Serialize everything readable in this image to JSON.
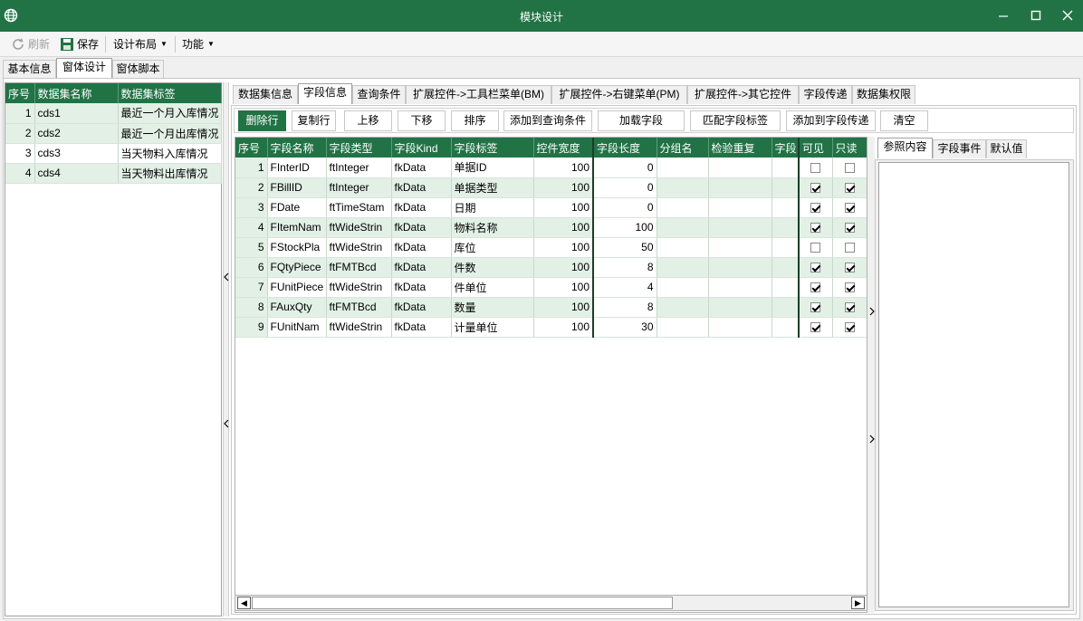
{
  "window": {
    "title": "模块设计"
  },
  "toolbar": {
    "refresh": "刷新",
    "save": "保存",
    "design_layout": "设计布局",
    "functions": "功能"
  },
  "main_tabs": [
    "基本信息",
    "窗体设计",
    "窗体脚本"
  ],
  "dataset_grid": {
    "headers": [
      "序号",
      "数据集名称",
      "数据集标签"
    ],
    "rows": [
      [
        "1",
        "cds1",
        "最近一个月入库情况"
      ],
      [
        "2",
        "cds2",
        "最近一个月出库情况"
      ],
      [
        "3",
        "cds3",
        "当天物料入库情况"
      ],
      [
        "4",
        "cds4",
        "当天物料出库情况"
      ]
    ]
  },
  "sub_tabs": [
    "数据集信息",
    "字段信息",
    "查询条件",
    "扩展控件->工具栏菜单(BM)",
    "扩展控件->右键菜单(PM)",
    "扩展控件->其它控件",
    "字段传递",
    "数据集权限"
  ],
  "buttons": [
    "删除行",
    "复制行",
    "上移",
    "下移",
    "排序",
    "添加到查询条件",
    "加载字段",
    "匹配字段标签",
    "添加到字段传递",
    "清空"
  ],
  "field_grid": {
    "headers": [
      "序号",
      "字段名称",
      "字段类型",
      "字段Kind",
      "字段标签",
      "控件宽度",
      "字段长度",
      "分组名",
      "检验重复",
      "字段",
      "可见",
      "只读"
    ],
    "rows": [
      {
        "no": "1",
        "name": "FInterID",
        "type": "ftInteger",
        "kind": "fkData",
        "label": "单据ID",
        "width": "100",
        "length": "0",
        "visible": false,
        "readonly": false
      },
      {
        "no": "2",
        "name": "FBillID",
        "type": "ftInteger",
        "kind": "fkData",
        "label": "单据类型",
        "width": "100",
        "length": "0",
        "visible": true,
        "readonly": true
      },
      {
        "no": "3",
        "name": "FDate",
        "type": "ftTimeStam",
        "kind": "fkData",
        "label": "日期",
        "width": "100",
        "length": "0",
        "visible": true,
        "readonly": true
      },
      {
        "no": "4",
        "name": "FItemNam",
        "type": "ftWideStrin",
        "kind": "fkData",
        "label": "物料名称",
        "width": "100",
        "length": "100",
        "visible": true,
        "readonly": true
      },
      {
        "no": "5",
        "name": "FStockPla",
        "type": "ftWideStrin",
        "kind": "fkData",
        "label": "库位",
        "width": "100",
        "length": "50",
        "visible": false,
        "readonly": false
      },
      {
        "no": "6",
        "name": "FQtyPiece",
        "type": "ftFMTBcd",
        "kind": "fkData",
        "label": "件数",
        "width": "100",
        "length": "8",
        "visible": true,
        "readonly": true
      },
      {
        "no": "7",
        "name": "FUnitPiece",
        "type": "ftWideStrin",
        "kind": "fkData",
        "label": "件单位",
        "width": "100",
        "length": "4",
        "visible": true,
        "readonly": true
      },
      {
        "no": "8",
        "name": "FAuxQty",
        "type": "ftFMTBcd",
        "kind": "fkData",
        "label": "数量",
        "width": "100",
        "length": "8",
        "visible": true,
        "readonly": true
      },
      {
        "no": "9",
        "name": "FUnitNam",
        "type": "ftWideStrin",
        "kind": "fkData",
        "label": "计量单位",
        "width": "100",
        "length": "30",
        "visible": true,
        "readonly": true
      }
    ]
  },
  "ref_tabs": [
    "参照内容",
    "字段事件",
    "默认值"
  ],
  "colors": {
    "accent": "#217346",
    "row_alt": "#e2f0e6"
  }
}
